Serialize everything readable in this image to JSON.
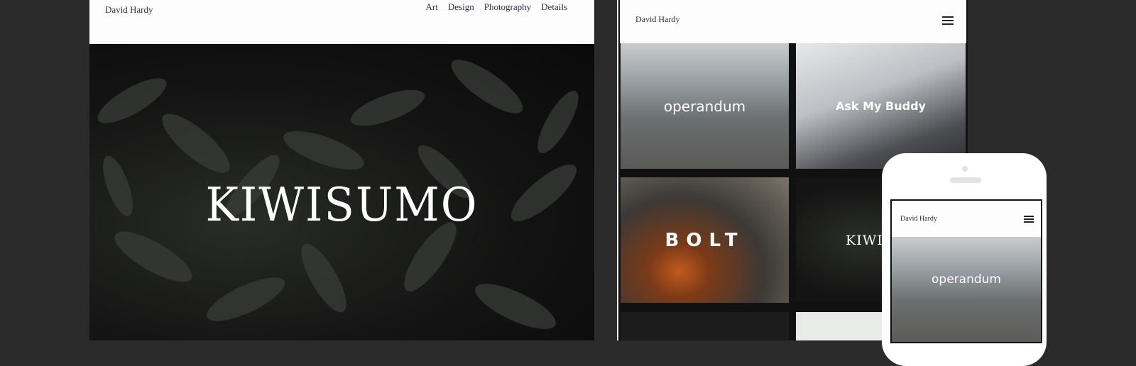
{
  "desktop": {
    "brand": "David Hardy",
    "nav": [
      "Art",
      "Design",
      "Photography",
      "Details"
    ],
    "hero_title": "KIWISUMO"
  },
  "tablet": {
    "brand": "David Hardy",
    "menu_icon": "hamburger-icon",
    "tiles": [
      "operandum",
      "Ask My Buddy",
      "BOLT",
      "KIWIS"
    ]
  },
  "phone": {
    "brand": "David Hardy",
    "menu_icon": "hamburger-icon",
    "tiles": [
      "operandum"
    ]
  },
  "colors": {
    "background": "#2b2b2b",
    "header": "#fdfdfd",
    "nav_text": "#2c2f4a"
  }
}
